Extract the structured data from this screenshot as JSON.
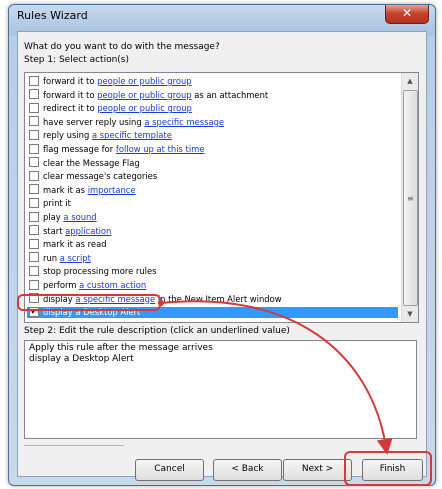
{
  "window": {
    "title": "Rules Wizard",
    "close_glyph": "✕"
  },
  "prompt": "What do you want to do with the message?",
  "step1_label": "Step 1: Select action(s)",
  "actions": [
    {
      "parts": [
        {
          "t": "forward it to "
        },
        {
          "t": "people or public group",
          "link": true
        }
      ],
      "checked": false
    },
    {
      "parts": [
        {
          "t": "forward it to "
        },
        {
          "t": "people or public group",
          "link": true
        },
        {
          "t": " as an attachment"
        }
      ],
      "checked": false
    },
    {
      "parts": [
        {
          "t": "redirect it to "
        },
        {
          "t": "people or public group",
          "link": true
        }
      ],
      "checked": false
    },
    {
      "parts": [
        {
          "t": "have server reply using "
        },
        {
          "t": "a specific message",
          "link": true
        }
      ],
      "checked": false
    },
    {
      "parts": [
        {
          "t": "reply using "
        },
        {
          "t": "a specific template",
          "link": true
        }
      ],
      "checked": false
    },
    {
      "parts": [
        {
          "t": "flag message for "
        },
        {
          "t": "follow up at this time",
          "link": true
        }
      ],
      "checked": false
    },
    {
      "parts": [
        {
          "t": "clear the Message Flag"
        }
      ],
      "checked": false
    },
    {
      "parts": [
        {
          "t": "clear message's categories"
        }
      ],
      "checked": false
    },
    {
      "parts": [
        {
          "t": "mark it as "
        },
        {
          "t": "importance",
          "link": true
        }
      ],
      "checked": false
    },
    {
      "parts": [
        {
          "t": "print it"
        }
      ],
      "checked": false
    },
    {
      "parts": [
        {
          "t": "play "
        },
        {
          "t": "a sound",
          "link": true
        }
      ],
      "checked": false
    },
    {
      "parts": [
        {
          "t": "start "
        },
        {
          "t": "application",
          "link": true
        }
      ],
      "checked": false
    },
    {
      "parts": [
        {
          "t": "mark it as read"
        }
      ],
      "checked": false
    },
    {
      "parts": [
        {
          "t": "run "
        },
        {
          "t": "a script",
          "link": true
        }
      ],
      "checked": false
    },
    {
      "parts": [
        {
          "t": "stop processing more rules"
        }
      ],
      "checked": false
    },
    {
      "parts": [
        {
          "t": "perform "
        },
        {
          "t": "a custom action",
          "link": true
        }
      ],
      "checked": false
    },
    {
      "parts": [
        {
          "t": "display "
        },
        {
          "t": "a specific message",
          "link": true
        },
        {
          "t": " in the New Item Alert window"
        }
      ],
      "checked": false
    },
    {
      "parts": [
        {
          "t": "display a Desktop Alert"
        }
      ],
      "checked": true,
      "selected": true
    }
  ],
  "step2_label": "Step 2: Edit the rule description (click an underlined value)",
  "description": [
    "Apply this rule after the message arrives",
    "display a Desktop Alert"
  ],
  "buttons": {
    "cancel": "Cancel",
    "back": "< Back",
    "next": "Next >",
    "finish": "Finish"
  },
  "check_glyph": "✔",
  "colors": {
    "highlight": "#3399ff",
    "annotation": "#d43a3a",
    "link": "#1a3bd6"
  }
}
